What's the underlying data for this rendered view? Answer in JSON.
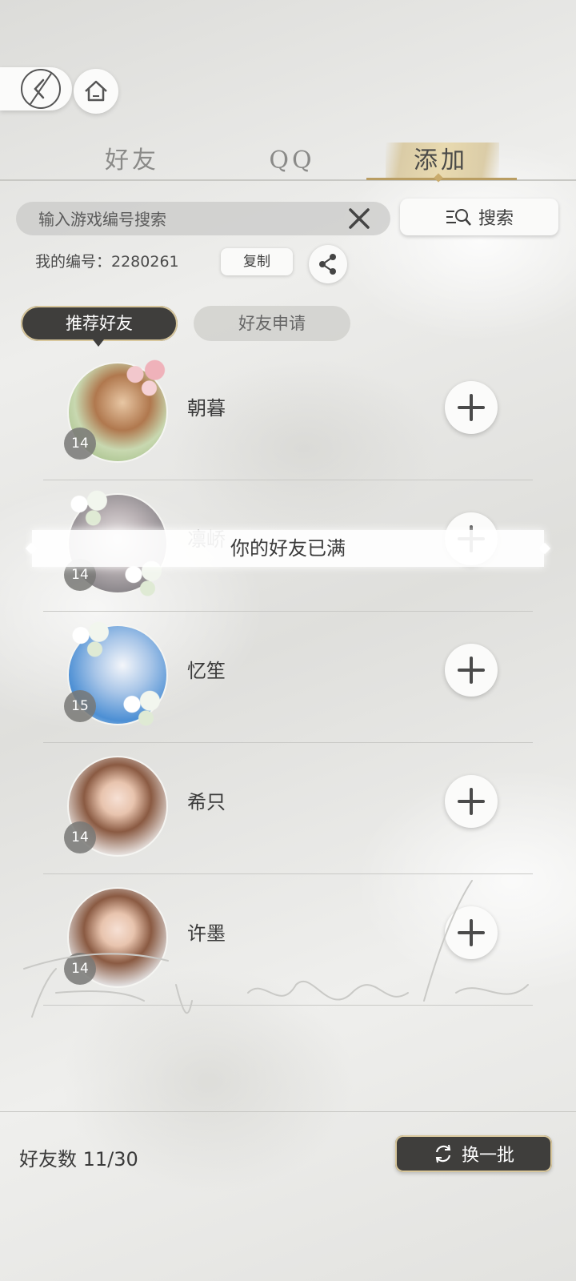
{
  "nav": {
    "back_icon": "back-arrow-icon",
    "home_icon": "home-icon"
  },
  "tabs": [
    {
      "label": "好友",
      "active": false
    },
    {
      "label": "QQ",
      "active": false
    },
    {
      "label": "添加",
      "active": true
    }
  ],
  "search": {
    "placeholder": "输入游戏编号搜索",
    "button_label": "搜索"
  },
  "my_id": {
    "text": "我的编号：2280261",
    "copy_label": "复制"
  },
  "subtabs": [
    {
      "label": "推荐好友",
      "active": true
    },
    {
      "label": "好友申请",
      "active": false
    }
  ],
  "recommended": [
    {
      "name": "朝暮",
      "level": "14"
    },
    {
      "name": "凛峤",
      "level": "14"
    },
    {
      "name": "忆笙",
      "level": "15"
    },
    {
      "name": "希只",
      "level": "14"
    },
    {
      "name": "许墨",
      "level": "14"
    }
  ],
  "toast": "你的好友已满",
  "footer": {
    "friend_count": "好友数 11/30",
    "refresh_label": "换一批"
  },
  "colors": {
    "accent_gold": "#b99d62",
    "dark_button": "#3f3e3c"
  }
}
